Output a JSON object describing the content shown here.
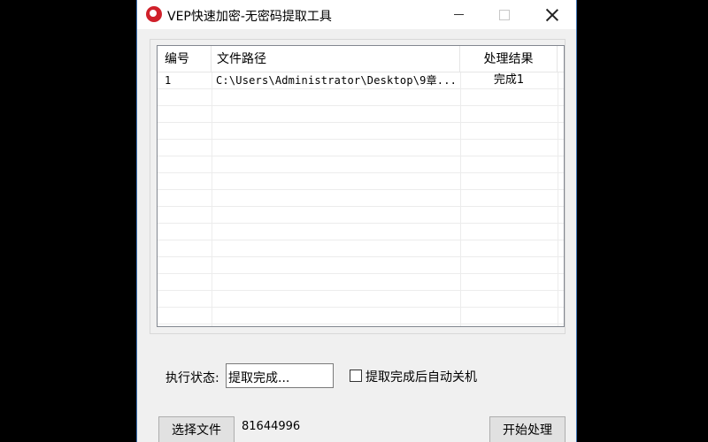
{
  "window": {
    "title": "VEP快速加密-无密码提取工具"
  },
  "list": {
    "columns": [
      "编号",
      "文件路径",
      "处理结果"
    ],
    "rows": [
      {
        "num": "1",
        "path": "C:\\Users\\Administrator\\Desktop\\9章...",
        "result": "完成1"
      }
    ]
  },
  "status": {
    "label": "执行状态:",
    "value": "提取完成..."
  },
  "options": {
    "auto_shutdown_label": "提取完成后自动关机",
    "auto_shutdown_checked": false
  },
  "buttons": {
    "select_file": "选择文件",
    "start": "开始处理"
  },
  "footer": {
    "code": "81644996"
  },
  "colors": {
    "app_icon": "#d0202a",
    "window_bg": "#f0f0f0",
    "outer_bg": "#000000"
  }
}
